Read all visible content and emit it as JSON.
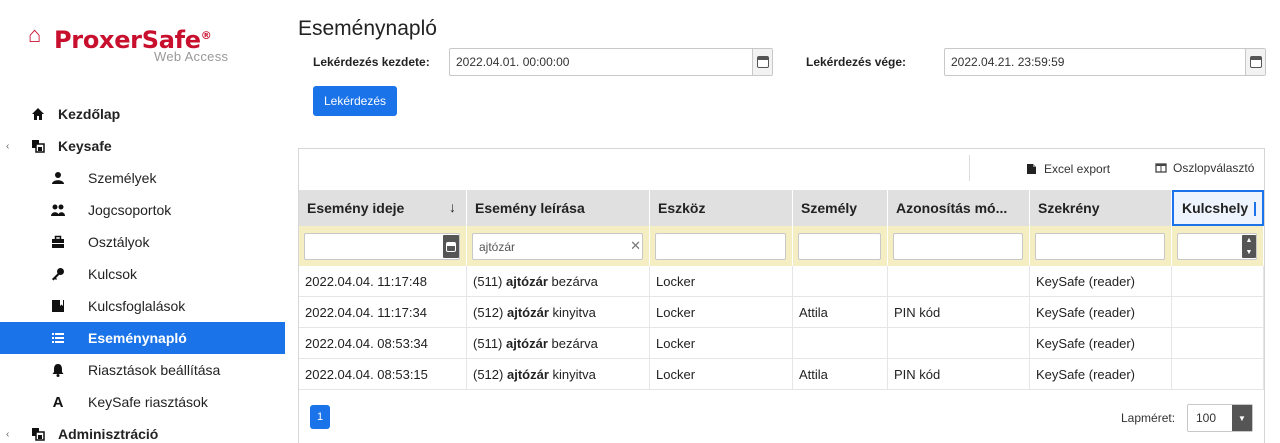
{
  "brand": {
    "name": "ProxerSafe",
    "reg": "®",
    "subtitle": "Web Access",
    "color": "#c8102e"
  },
  "sidebar": {
    "items": [
      {
        "label": "Kezdőlap",
        "icon": "home-icon",
        "level": "top"
      },
      {
        "label": "Keysafe",
        "icon": "copy-icon",
        "level": "top"
      },
      {
        "label": "Személyek",
        "icon": "user-icon",
        "level": "sub"
      },
      {
        "label": "Jogcsoportok",
        "icon": "users-icon",
        "level": "sub"
      },
      {
        "label": "Osztályok",
        "icon": "briefcase-icon",
        "level": "sub"
      },
      {
        "label": "Kulcsok",
        "icon": "key-icon",
        "level": "sub"
      },
      {
        "label": "Kulcsfoglalások",
        "icon": "bookmark-icon",
        "level": "sub"
      },
      {
        "label": "Eseménynapló",
        "icon": "list-icon",
        "level": "sub",
        "active": true
      },
      {
        "label": "Riasztások beállítása",
        "icon": "bell-icon",
        "level": "sub"
      },
      {
        "label": "KeySafe riasztások",
        "icon": "letter-a-icon",
        "level": "sub"
      },
      {
        "label": "Adminisztráció",
        "icon": "copy-icon",
        "level": "top"
      }
    ]
  },
  "page": {
    "title": "Eseménynapló"
  },
  "filters": {
    "start_label": "Lekérdezés kezdete:",
    "start_value": "2022.04.01. 00:00:00",
    "end_label": "Lekérdezés vége:",
    "end_value": "2022.04.21. 23:59:59",
    "query_button": "Lekérdezés"
  },
  "toolbar": {
    "excel_export": "Excel export",
    "column_chooser": "Oszlopválasztó"
  },
  "table": {
    "columns": [
      "Esemény ideje",
      "Esemény leírása",
      "Eszköz",
      "Személy",
      "Azonosítás mó...",
      "Szekrény",
      "Kulcshely"
    ],
    "column_filters": {
      "description": "ajtózár"
    },
    "rows": [
      {
        "time": "2022.04.04. 11:17:48",
        "code": "(511)",
        "keyword": "ajtózár",
        "action": "bezárva",
        "device": "Locker",
        "person": "",
        "auth": "",
        "cabinet": "KeySafe (reader)",
        "slot": ""
      },
      {
        "time": "2022.04.04. 11:17:34",
        "code": "(512)",
        "keyword": "ajtózár",
        "action": "kinyitva",
        "device": "Locker",
        "person": "Attila",
        "auth": "PIN kód",
        "cabinet": "KeySafe (reader)",
        "slot": ""
      },
      {
        "time": "2022.04.04. 08:53:34",
        "code": "(511)",
        "keyword": "ajtózár",
        "action": "bezárva",
        "device": "Locker",
        "person": "",
        "auth": "",
        "cabinet": "KeySafe (reader)",
        "slot": ""
      },
      {
        "time": "2022.04.04. 08:53:15",
        "code": "(512)",
        "keyword": "ajtózár",
        "action": "kinyitva",
        "device": "Locker",
        "person": "Attila",
        "auth": "PIN kód",
        "cabinet": "KeySafe (reader)",
        "slot": ""
      }
    ]
  },
  "pager": {
    "current_page": "1",
    "page_size_label": "Lapméret:",
    "page_size": "100"
  },
  "colors": {
    "accent": "#1a73e8",
    "filter_row": "#f6eec3",
    "header_row": "#e0e0e0"
  }
}
